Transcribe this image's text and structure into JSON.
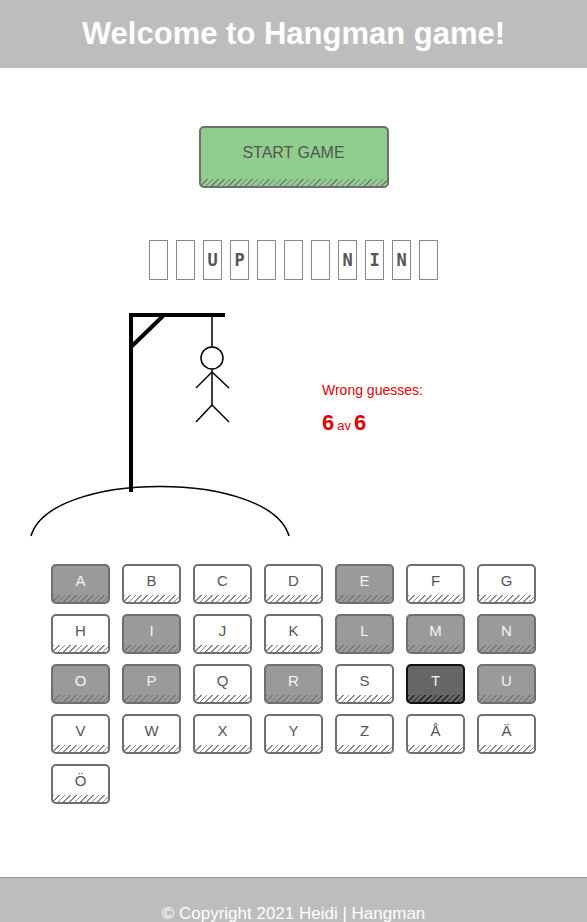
{
  "header": {
    "title": "Welcome to Hangman game!"
  },
  "start_button": {
    "label": "START GAME"
  },
  "word": {
    "slots": [
      "",
      "",
      "U",
      "P",
      "",
      "",
      "",
      "N",
      "I",
      "N",
      ""
    ]
  },
  "wrong_guesses": {
    "label": "Wrong guesses:",
    "count": "6",
    "separator": "av",
    "max": "6"
  },
  "keyboard": {
    "keys": [
      {
        "letter": "A",
        "guessed": true,
        "selected": false
      },
      {
        "letter": "B",
        "guessed": false,
        "selected": false
      },
      {
        "letter": "C",
        "guessed": false,
        "selected": false
      },
      {
        "letter": "D",
        "guessed": false,
        "selected": false
      },
      {
        "letter": "E",
        "guessed": true,
        "selected": false
      },
      {
        "letter": "F",
        "guessed": false,
        "selected": false
      },
      {
        "letter": "G",
        "guessed": false,
        "selected": false
      },
      {
        "letter": "H",
        "guessed": false,
        "selected": false
      },
      {
        "letter": "I",
        "guessed": true,
        "selected": false
      },
      {
        "letter": "J",
        "guessed": false,
        "selected": false
      },
      {
        "letter": "K",
        "guessed": false,
        "selected": false
      },
      {
        "letter": "L",
        "guessed": true,
        "selected": false
      },
      {
        "letter": "M",
        "guessed": true,
        "selected": false
      },
      {
        "letter": "N",
        "guessed": true,
        "selected": false
      },
      {
        "letter": "O",
        "guessed": true,
        "selected": false
      },
      {
        "letter": "P",
        "guessed": true,
        "selected": false
      },
      {
        "letter": "Q",
        "guessed": false,
        "selected": false
      },
      {
        "letter": "R",
        "guessed": true,
        "selected": false
      },
      {
        "letter": "S",
        "guessed": false,
        "selected": false
      },
      {
        "letter": "T",
        "guessed": true,
        "selected": true
      },
      {
        "letter": "U",
        "guessed": true,
        "selected": false
      },
      {
        "letter": "V",
        "guessed": false,
        "selected": false
      },
      {
        "letter": "W",
        "guessed": false,
        "selected": false
      },
      {
        "letter": "X",
        "guessed": false,
        "selected": false
      },
      {
        "letter": "Y",
        "guessed": false,
        "selected": false
      },
      {
        "letter": "Z",
        "guessed": false,
        "selected": false
      },
      {
        "letter": "Å",
        "guessed": false,
        "selected": false
      },
      {
        "letter": "Ä",
        "guessed": false,
        "selected": false
      },
      {
        "letter": "Ö",
        "guessed": false,
        "selected": false
      }
    ]
  },
  "footer": {
    "text": "© Copyright 2021 Heidi | Hangman"
  }
}
